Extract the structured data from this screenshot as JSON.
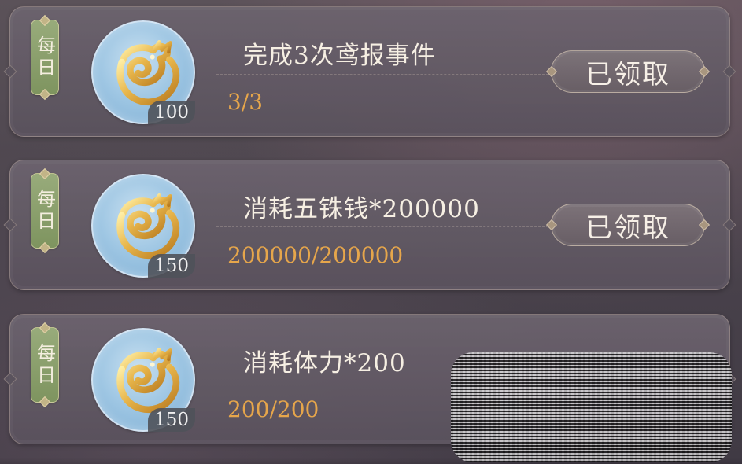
{
  "screen": {
    "background_color": "#4a434c",
    "accent_color": "#e6a64b",
    "tag_color": "#8ea46d",
    "medallion_color": "#9ec6e3"
  },
  "tasks": [
    {
      "tag": "每日",
      "title": "完成3次鸢报事件",
      "progress": "3/3",
      "reward_count": "100",
      "reward_icon": "golden-dragon-jade-icon",
      "button": "已领取"
    },
    {
      "tag": "每日",
      "title": "消耗五铢钱*200000",
      "progress": "200000/200000",
      "reward_count": "150",
      "reward_icon": "golden-dragon-jade-icon",
      "button": "已领取"
    },
    {
      "tag": "每日",
      "title": "消耗体力*200",
      "progress": "200/200",
      "reward_count": "150",
      "reward_icon": "golden-dragon-jade-icon"
    }
  ]
}
